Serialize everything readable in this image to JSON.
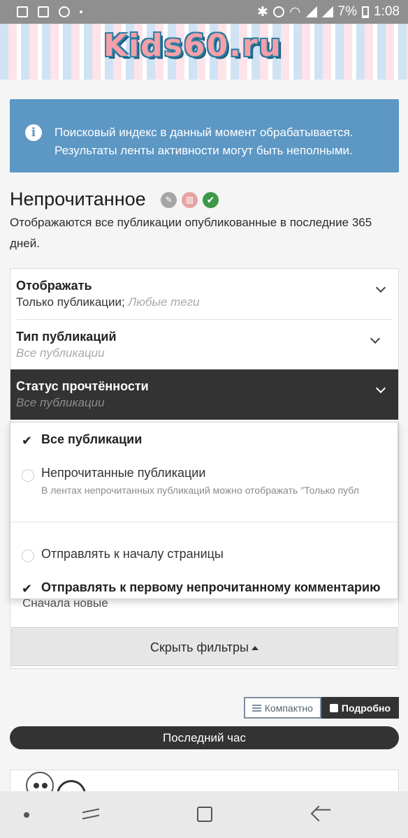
{
  "status_bar": {
    "battery": "7%",
    "time": "1:08"
  },
  "header": {
    "logo_text": "Kids60.ru"
  },
  "info_notice": {
    "text": "Поисковый индекс в данный момент обрабатывается. Результаты ленты активности могут быть неполными."
  },
  "page": {
    "title": "Непрочитанное",
    "description": "Отображаются все публикации опубликованные в последние 365 дней."
  },
  "filters": {
    "rows": [
      {
        "label": "Отображать",
        "value": "Только публикации;",
        "hint": "Любые теги"
      },
      {
        "label": "Тип публикаций",
        "value": "",
        "hint": "Все публикации"
      },
      {
        "label": "Статус прочтённости",
        "value": "",
        "hint": "Все публикации"
      }
    ],
    "sort_partial": "Сначала новые",
    "hide_button": "Скрыть фильтры"
  },
  "dropdown": {
    "items": [
      {
        "label": "Все публикации",
        "checked": true
      },
      {
        "label": "Непрочитанные публикации",
        "sub": "В лентах непрочитанных публикаций можно отображать \"Только публ",
        "checked": false
      },
      {
        "label": "Отправлять к началу страницы",
        "checked": false
      },
      {
        "label": "Отправлять к первому непрочитанному комментарию",
        "checked": true
      }
    ]
  },
  "view_toggle": {
    "compact": "Компактно",
    "detailed": "Подробно"
  },
  "time_filter": {
    "label": "Последний час"
  },
  "colors": {
    "info_bg": "#5d97c4",
    "dark": "#333333",
    "success": "#3f9848"
  }
}
